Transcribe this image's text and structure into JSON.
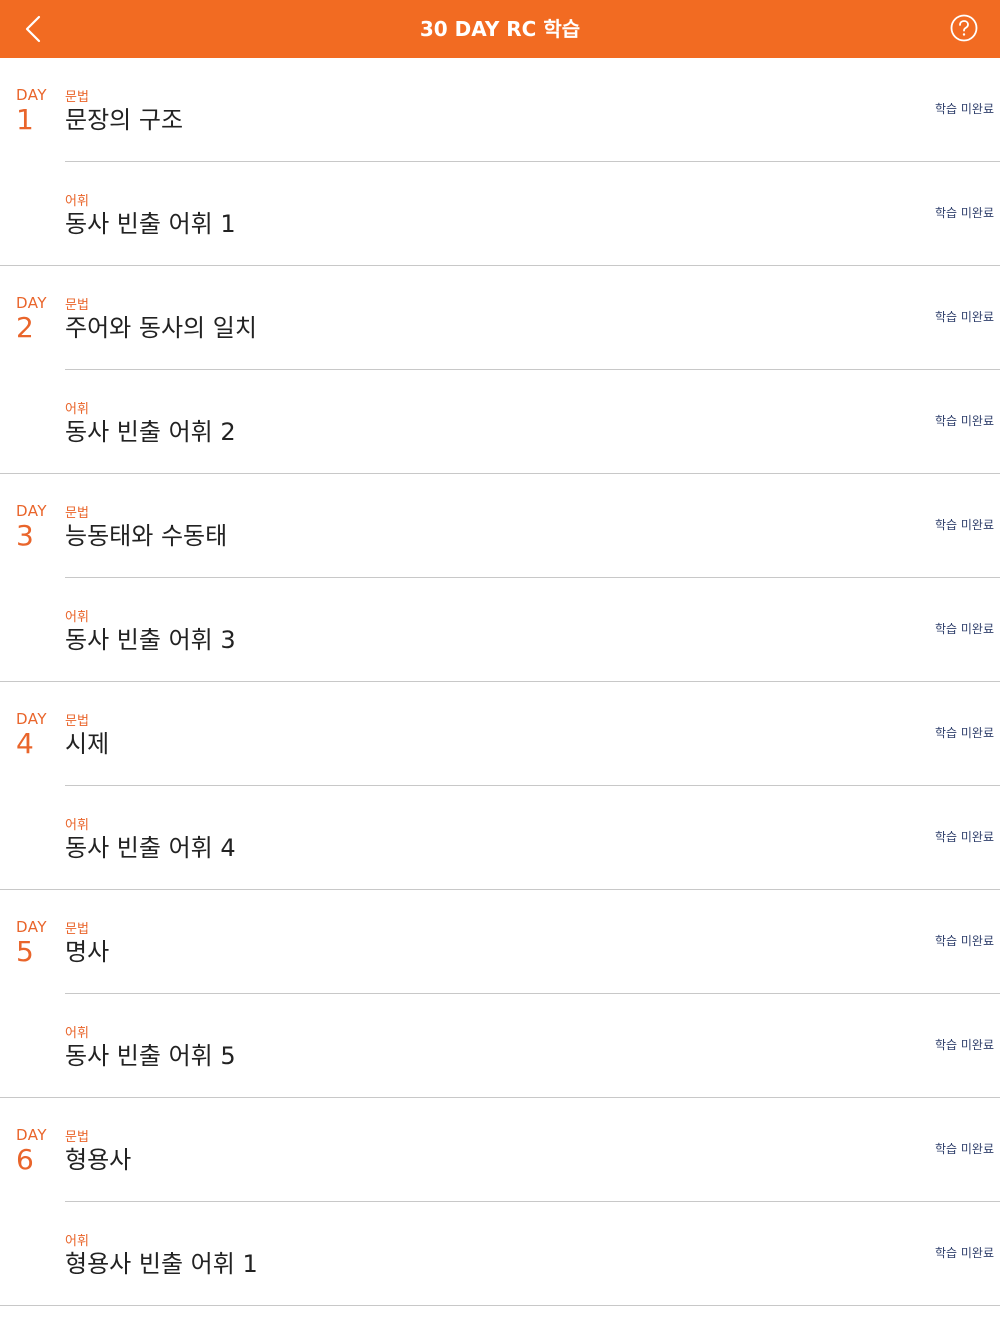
{
  "header": {
    "title": "30 DAY RC 학습",
    "back_icon": "chevron-left-icon",
    "help_icon": "question-circle-icon",
    "bar_color": "#f26b22"
  },
  "accent_color": "#e9652b",
  "days": [
    {
      "label": "DAY",
      "number": "1",
      "lessons": [
        {
          "category": "문법",
          "title": "문장의 구조",
          "status": "학습 미완료"
        },
        {
          "category": "어휘",
          "title": "동사 빈출 어휘 1",
          "status": "학습 미완료"
        }
      ]
    },
    {
      "label": "DAY",
      "number": "2",
      "lessons": [
        {
          "category": "문법",
          "title": "주어와 동사의 일치",
          "status": "학습 미완료"
        },
        {
          "category": "어휘",
          "title": "동사 빈출 어휘 2",
          "status": "학습 미완료"
        }
      ]
    },
    {
      "label": "DAY",
      "number": "3",
      "lessons": [
        {
          "category": "문법",
          "title": "능동태와 수동태",
          "status": "학습 미완료"
        },
        {
          "category": "어휘",
          "title": "동사 빈출 어휘 3",
          "status": "학습 미완료"
        }
      ]
    },
    {
      "label": "DAY",
      "number": "4",
      "lessons": [
        {
          "category": "문법",
          "title": "시제",
          "status": "학습 미완료"
        },
        {
          "category": "어휘",
          "title": "동사 빈출 어휘 4",
          "status": "학습 미완료"
        }
      ]
    },
    {
      "label": "DAY",
      "number": "5",
      "lessons": [
        {
          "category": "문법",
          "title": "명사",
          "status": "학습 미완료"
        },
        {
          "category": "어휘",
          "title": "동사 빈출 어휘 5",
          "status": "학습 미완료"
        }
      ]
    },
    {
      "label": "DAY",
      "number": "6",
      "lessons": [
        {
          "category": "문법",
          "title": "형용사",
          "status": "학습 미완료"
        },
        {
          "category": "어휘",
          "title": "형용사 빈출 어휘 1",
          "status": "학습 미완료"
        }
      ]
    }
  ]
}
